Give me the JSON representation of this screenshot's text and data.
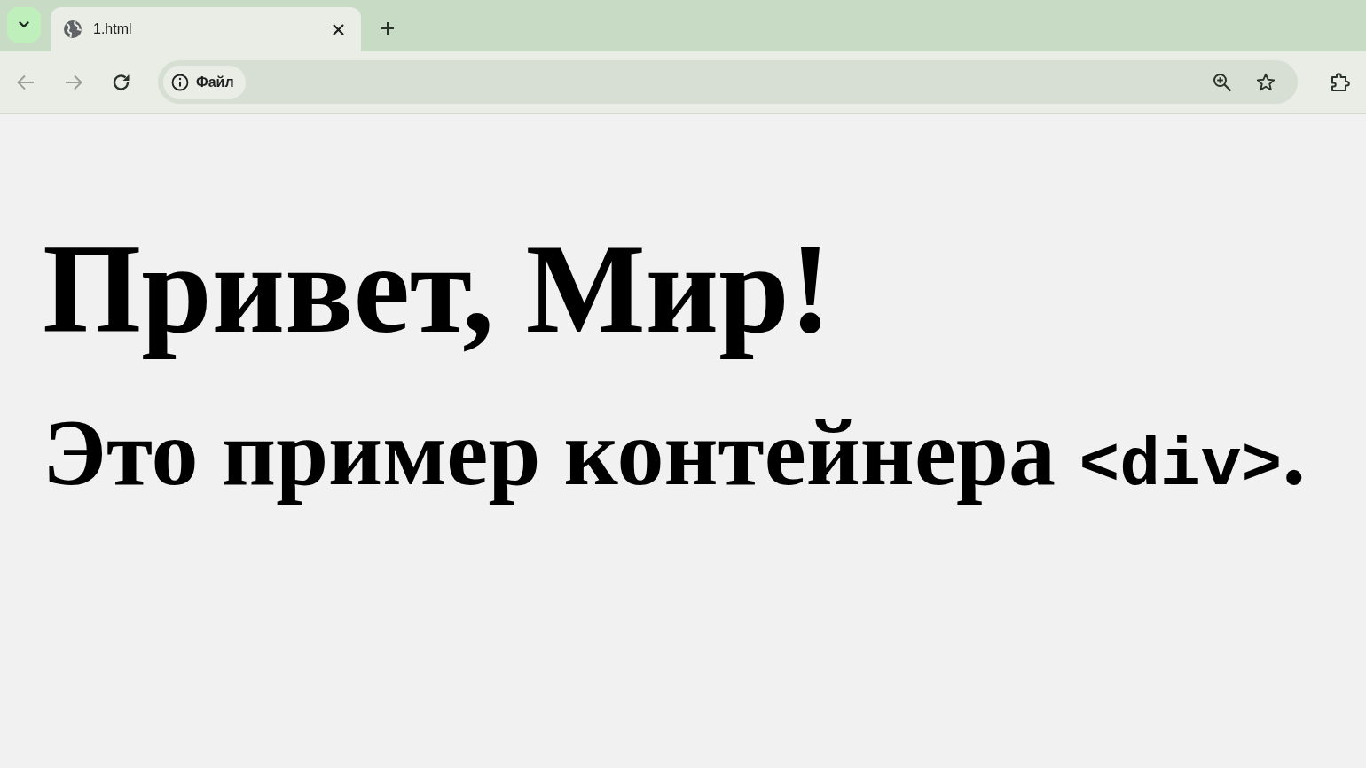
{
  "browser": {
    "tabs": [
      {
        "title": "1.html",
        "selected": true
      }
    ],
    "nav_buttons": [
      {
        "kind": "back",
        "disabled": true
      },
      {
        "kind": "forward",
        "disabled": true
      },
      {
        "kind": "reload",
        "disabled": false
      }
    ],
    "address_bar": {
      "chip_label": "Файл"
    }
  },
  "page": {
    "heading": "Привет, Мир!",
    "paragraph": [
      {
        "kind": "text",
        "text": "Это пример контейнера "
      },
      {
        "kind": "code",
        "text": "<div>"
      },
      {
        "kind": "text",
        "text": "."
      }
    ]
  }
}
